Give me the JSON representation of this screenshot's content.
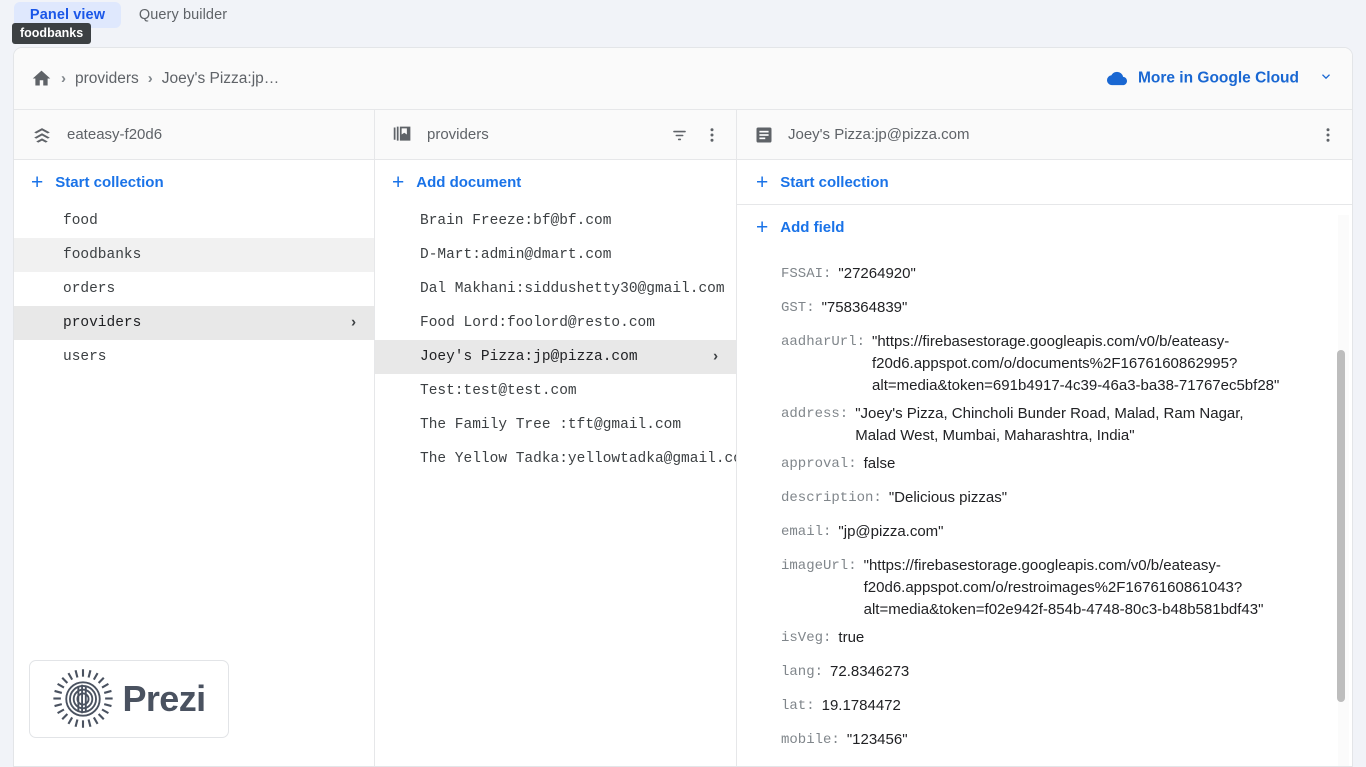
{
  "tabs": [
    {
      "id": "panel-view",
      "label": "Panel view",
      "active": true
    },
    {
      "id": "query-builder",
      "label": "Query builder",
      "active": false
    }
  ],
  "tooltip": {
    "text": "foodbanks"
  },
  "breadcrumb": {
    "home_icon": "home-icon",
    "separator": "›",
    "items": [
      {
        "label": "providers"
      },
      {
        "label": "Joey's Pizza:jp…"
      }
    ]
  },
  "more_in_google_cloud": {
    "label": "More in Google Cloud",
    "icon": "cloud-icon",
    "chevron": "⌄",
    "color": "#1967d2"
  },
  "columns": {
    "database": {
      "icon": "firestore-database-icon",
      "title": "eateasy-f20d6",
      "action": {
        "label": "Start collection",
        "plus": "+"
      },
      "items": [
        {
          "label": "food",
          "state": "normal"
        },
        {
          "label": "foodbanks",
          "state": "hovered"
        },
        {
          "label": "orders",
          "state": "normal"
        },
        {
          "label": "providers",
          "state": "selected",
          "chevron": "›"
        },
        {
          "label": "users",
          "state": "normal"
        }
      ]
    },
    "collection": {
      "icon": "collection-icon",
      "title": "providers",
      "filter_icon": "filter-icon",
      "menu_icon": "more-vert-icon",
      "action": {
        "label": "Add document",
        "plus": "+"
      },
      "items": [
        {
          "label": "Brain Freeze:bf@bf.com",
          "state": "normal"
        },
        {
          "label": "D-Mart:admin@dmart.com",
          "state": "normal"
        },
        {
          "label": "Dal Makhani:siddushetty30@gmail.com",
          "state": "normal"
        },
        {
          "label": "Food Lord:foolord@resto.com",
          "state": "normal"
        },
        {
          "label": "Joey's Pizza:jp@pizza.com",
          "state": "selected",
          "chevron": "›"
        },
        {
          "label": "Test:test@test.com",
          "state": "normal"
        },
        {
          "label": "The Family Tree :tft@gmail.com",
          "state": "normal"
        },
        {
          "label": "The Yellow Tadka:yellowtadka@gmail.com",
          "state": "normal"
        }
      ]
    },
    "document": {
      "icon": "document-icon",
      "title": "Joey's Pizza:jp@pizza.com",
      "menu_icon": "more-vert-icon",
      "action_start_collection": {
        "label": "Start collection",
        "plus": "+"
      },
      "action_add_field": {
        "label": "Add field",
        "plus": "+"
      },
      "fields": [
        {
          "key": "FSSAI:",
          "value": "\"27264920\"",
          "wrap": false
        },
        {
          "key": "GST:",
          "value": "\"758364839\"",
          "wrap": false
        },
        {
          "key": "aadharUrl:",
          "value": "\"https://firebasestorage.googleapis.com/v0/b/eateasy-f20d6.appspot.com/o/documents%2F1676160862995?alt=media&token=691b4917-4c39-46a3-ba38-71767ec5bf28\"",
          "wrap": true
        },
        {
          "key": "address:",
          "value": "\"Joey's Pizza, Chincholi Bunder Road, Malad, Ram Nagar, Malad West, Mumbai, Maharashtra, India\"",
          "wrap": true
        },
        {
          "key": "approval:",
          "value": "false",
          "wrap": false
        },
        {
          "key": "description:",
          "value": "\"Delicious pizzas\"",
          "wrap": false
        },
        {
          "key": "email:",
          "value": "\"jp@pizza.com\"",
          "wrap": false
        },
        {
          "key": "imageUrl:",
          "value": "\"https://firebasestorage.googleapis.com/v0/b/eateasy-f20d6.appspot.com/o/restroimages%2F1676160861043?alt=media&token=f02e942f-854b-4748-80c3-b48b581bdf43\"",
          "wrap": true
        },
        {
          "key": "isVeg:",
          "value": "true",
          "wrap": false
        },
        {
          "key": "lang:",
          "value": "72.8346273",
          "wrap": false
        },
        {
          "key": "lat:",
          "value": "19.1784472",
          "wrap": false
        },
        {
          "key": "mobile:",
          "value": "\"123456\"",
          "wrap": false
        }
      ]
    }
  },
  "watermark": {
    "brand": "Prezi",
    "icon": "prezi-logo-icon"
  },
  "colors": {
    "accent_blue": "#1a73e8",
    "tab_active_bg": "#dfe8fd",
    "selected_row": "#e8e8e8",
    "hovered_row": "#f1f1f1",
    "page_bg": "#f1f3f8"
  }
}
